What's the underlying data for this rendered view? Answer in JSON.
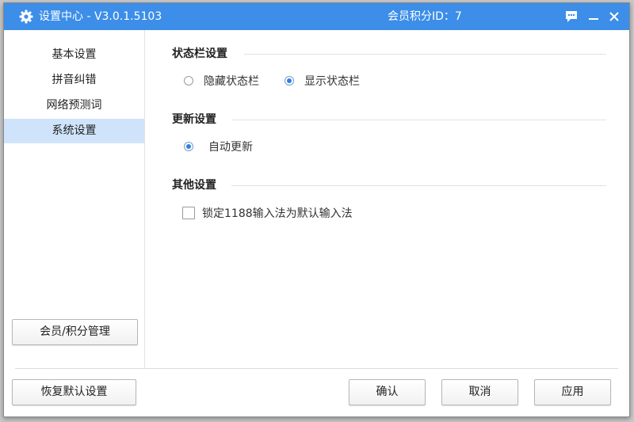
{
  "titlebar": {
    "title": "设置中心  - V3.0.1.5103",
    "member_id": "会员积分ID：7",
    "icons": [
      "gear-icon",
      "message-icon",
      "minimize-icon",
      "close-icon"
    ]
  },
  "sidebar": {
    "items": [
      {
        "label": "基本设置",
        "active": false
      },
      {
        "label": "拼音纠错",
        "active": false
      },
      {
        "label": "网络预测词",
        "active": false
      },
      {
        "label": "系统设置",
        "active": true
      }
    ],
    "member_button": "会员/积分管理"
  },
  "sections": {
    "statusbar": {
      "title": "状态栏设置",
      "options": [
        {
          "label": "隐藏状态栏",
          "checked": false
        },
        {
          "label": "显示状态栏",
          "checked": true
        }
      ]
    },
    "update": {
      "title": "更新设置",
      "options": [
        {
          "label": "自动更新",
          "checked": true
        }
      ]
    },
    "other": {
      "title": "其他设置",
      "checkbox": {
        "label": "锁定1188输入法为默认输入法",
        "checked": false
      }
    }
  },
  "footer": {
    "restore_label": "恢复默认设置",
    "ok_label": "确认",
    "cancel_label": "取消",
    "apply_label": "应用"
  },
  "colors": {
    "titlebar": "#3c8ee8",
    "active_nav": "#cfe4fb",
    "radio_dot": "#2f80e0"
  }
}
